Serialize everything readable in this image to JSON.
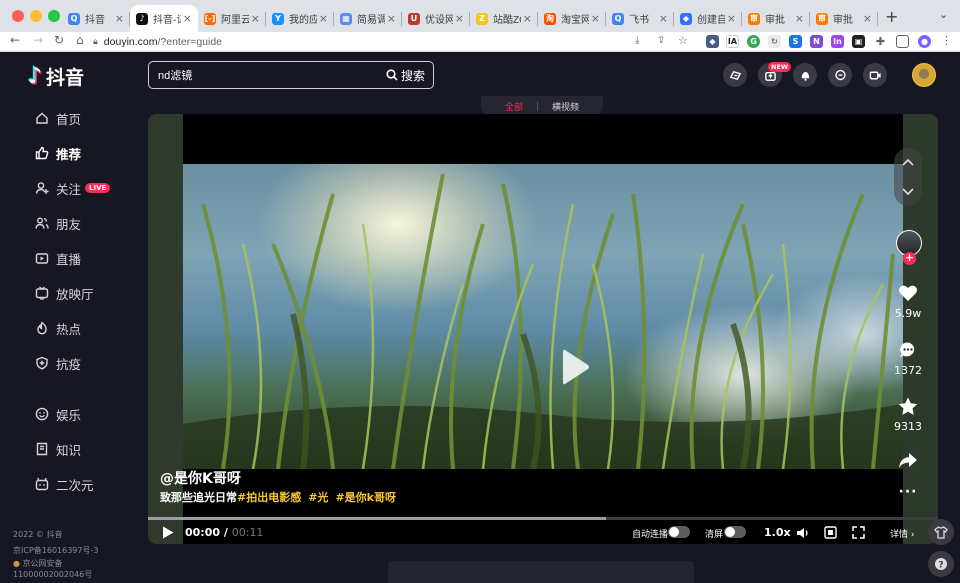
{
  "browser": {
    "tabs": [
      {
        "title": "抖音",
        "favicon_color": "#4285f4",
        "favicon": "Q"
      },
      {
        "title": "抖音-记录美好生活",
        "favicon_color": "#111111",
        "favicon": "♪",
        "active": true
      },
      {
        "title": "阿里云",
        "favicon_color": "#ff6a00",
        "favicon": "[-]"
      },
      {
        "title": "我的应用",
        "favicon_color": "#1890ff",
        "favicon": "Y"
      },
      {
        "title": "简易调查",
        "favicon_color": "#5b8def",
        "favicon": "▦"
      },
      {
        "title": "优设网",
        "favicon_color": "#c0392b",
        "favicon": "U"
      },
      {
        "title": "站酷ZCOOL",
        "favicon_color": "#f5c518",
        "favicon": "Z"
      },
      {
        "title": "淘宝网",
        "favicon_color": "#ff5000",
        "favicon": "淘"
      },
      {
        "title": "飞书",
        "favicon_color": "#4285f4",
        "favicon": "Q"
      },
      {
        "title": "创建自定义",
        "favicon_color": "#3370ff",
        "favicon": "◆"
      },
      {
        "title": "审批",
        "favicon_color": "#ff7a00",
        "favicon": "审"
      },
      {
        "title": "审批",
        "favicon_color": "#ff7a00",
        "favicon": "审"
      }
    ],
    "url_host": "douyin.com",
    "url_path": "/?enter=guide"
  },
  "brand": {
    "name": "抖音"
  },
  "sidebar": {
    "items": [
      {
        "label": "首页",
        "icon": "home-icon"
      },
      {
        "label": "推荐",
        "icon": "thumbs-up-icon",
        "active": true
      },
      {
        "label": "关注",
        "icon": "follow-icon",
        "badge": "LIVE"
      },
      {
        "label": "朋友",
        "icon": "friends-icon"
      },
      {
        "label": "直播",
        "icon": "live-icon"
      },
      {
        "label": "放映厅",
        "icon": "tv-icon"
      },
      {
        "label": "热点",
        "icon": "flame-icon"
      },
      {
        "label": "抗疫",
        "icon": "shield-plus-icon"
      },
      {
        "label": "娱乐",
        "icon": "smile-icon"
      },
      {
        "label": "知识",
        "icon": "book-icon"
      },
      {
        "label": "二次元",
        "icon": "anime-icon"
      }
    ],
    "footer": [
      "2022 © 抖音",
      "京ICP备16016397号-3",
      "京公网安备",
      "11000002002046号"
    ]
  },
  "search": {
    "query": "nd滤镜",
    "button_label": "搜索"
  },
  "header": {
    "new_badge": "NEW"
  },
  "feed_switch": {
    "all": "全部",
    "landscape": "横视频"
  },
  "video": {
    "author": "@是你K哥呀",
    "description": "致那些追光日常",
    "hashtags": [
      "#拍出电影感",
      "#光",
      "#是你k哥呀"
    ],
    "likes": "5.9w",
    "comments": "1372",
    "favorites": "9313",
    "time_current": "00:00",
    "time_separator": "/",
    "time_total": "00:11",
    "progress": 0.58,
    "autoplay_label": "自动连播",
    "clear_label": "清屏",
    "speed": "1.0x",
    "details_label": "详情 ›"
  }
}
